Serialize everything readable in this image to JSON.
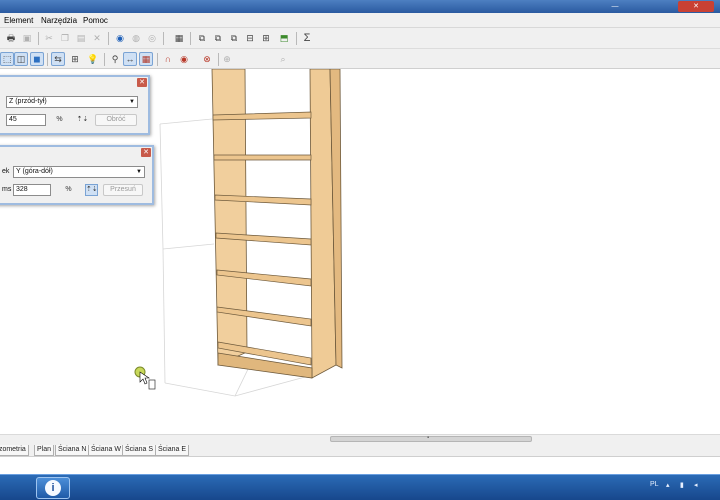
{
  "window": {
    "minimize_glyph": "—",
    "close_glyph": "✕"
  },
  "menu": [
    "Element",
    "Narzędzia",
    "Pomoc"
  ],
  "colors": {
    "title_bar": "#2a5aa0",
    "shelf_wood": "#f1cf9d",
    "taskbar": "#1e56a0",
    "panel_border": "#9ebbe0"
  },
  "toolbar_icons": [
    "print-icon",
    "cut-icon",
    "copy-icon",
    "paste-icon",
    "delete-icon",
    "globe-icon",
    "layers-icon",
    "table-icon",
    "sum-icon"
  ],
  "panel_front_back": {
    "axis_select": "Z (przód-tył)",
    "value": "45",
    "action_label": "Obróć"
  },
  "panel_top_bottom": {
    "label_partial": "ek",
    "axis_select": "Y (góra-dół)",
    "value_label": "ms",
    "value": "328",
    "action_label": "Przesuń"
  },
  "view_tabs": [
    "Izometria",
    "Plan",
    "Ściana N",
    "Ściana W",
    "Ściana S",
    "Ściana E"
  ],
  "tray": {
    "language": "PL"
  }
}
